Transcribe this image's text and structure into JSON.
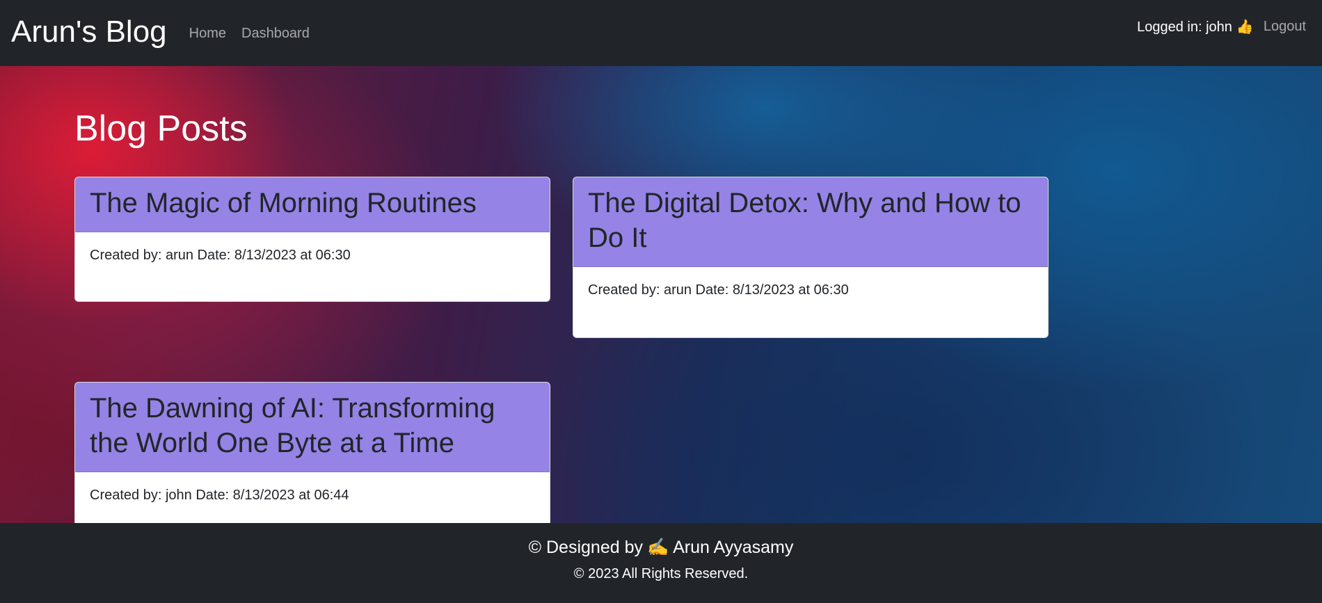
{
  "navbar": {
    "brand": "Arun's Blog",
    "links": [
      "Home",
      "Dashboard"
    ],
    "logged_in_text": "Logged in: john",
    "logged_in_emoji": "👍",
    "logout_label": "Logout"
  },
  "main": {
    "title": "Blog Posts",
    "posts": [
      {
        "title": "The Magic of Morning Routines",
        "meta": "Created by: arun Date: 8/13/2023 at 06:30"
      },
      {
        "title": "The Digital Detox: Why and How to Do It",
        "meta": "Created by: arun Date: 8/13/2023 at 06:30"
      },
      {
        "title": "The Dawning of AI: Transforming the World One Byte at a Time",
        "meta": "Created by: john Date: 8/13/2023 at 06:44"
      }
    ]
  },
  "footer": {
    "designed_prefix": "© Designed by",
    "designed_emoji": "✍️",
    "designer": "Arun Ayyasamy",
    "rights": "© 2023 All Rights Reserved."
  },
  "colors": {
    "navbar_bg": "#212529",
    "card_header_bg": "#9583e6",
    "footer_bg": "#212529"
  }
}
